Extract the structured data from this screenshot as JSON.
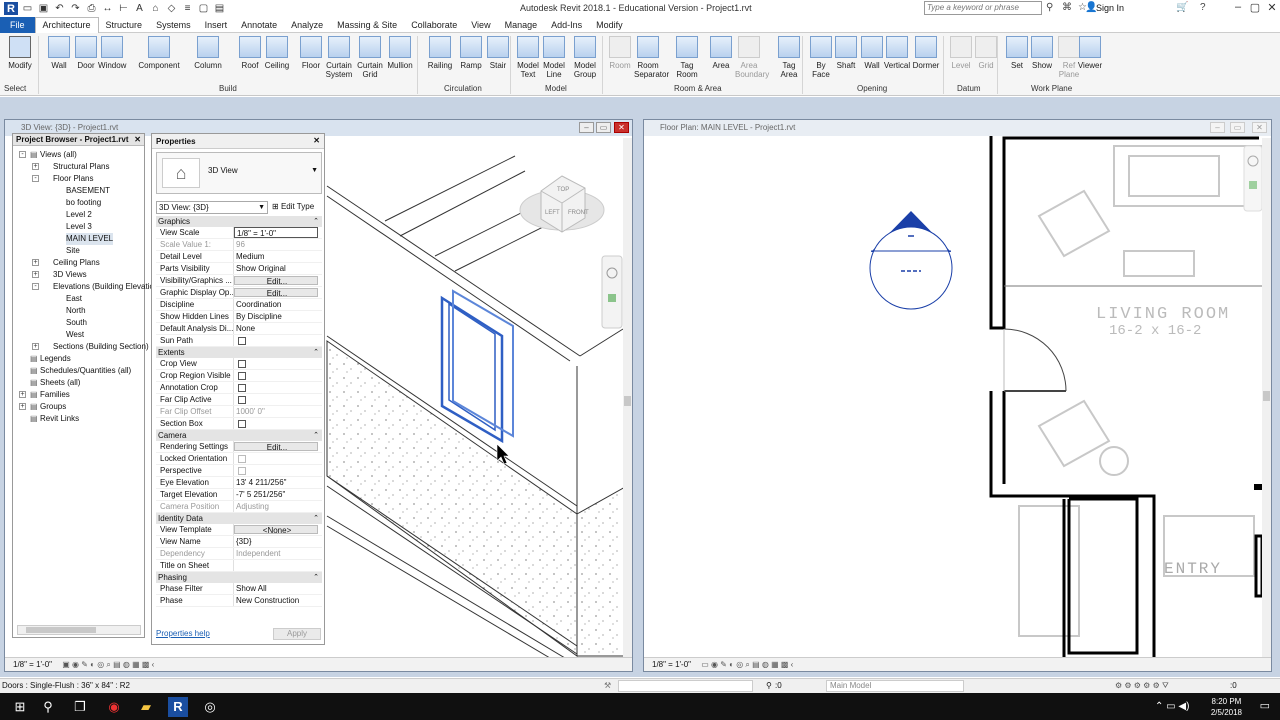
{
  "window": {
    "title": "Autodesk Revit 2018.1 - Educational Version -   Project1.rvt",
    "search_placeholder": "Type a keyword or phrase",
    "sign_in": "Sign In"
  },
  "ribbon": {
    "tabs": [
      "File",
      "Architecture",
      "Structure",
      "Systems",
      "Insert",
      "Annotate",
      "Analyze",
      "Massing & Site",
      "Collaborate",
      "View",
      "Manage",
      "Add-Ins",
      "Modify"
    ],
    "active_tab": "Architecture",
    "tools": [
      {
        "label": "Modify",
        "sub": ""
      },
      {
        "label": "Wall",
        "sub": ""
      },
      {
        "label": "Door",
        "sub": ""
      },
      {
        "label": "Window",
        "sub": ""
      },
      {
        "label": "Component",
        "sub": ""
      },
      {
        "label": "Column",
        "sub": ""
      },
      {
        "label": "Roof",
        "sub": ""
      },
      {
        "label": "Ceiling",
        "sub": ""
      },
      {
        "label": "Floor",
        "sub": ""
      },
      {
        "label": "Curtain",
        "sub": "System"
      },
      {
        "label": "Curtain",
        "sub": "Grid"
      },
      {
        "label": "Mullion",
        "sub": ""
      },
      {
        "label": "Railing",
        "sub": ""
      },
      {
        "label": "Ramp",
        "sub": ""
      },
      {
        "label": "Stair",
        "sub": ""
      },
      {
        "label": "Model",
        "sub": "Text"
      },
      {
        "label": "Model",
        "sub": "Line"
      },
      {
        "label": "Model",
        "sub": "Group"
      },
      {
        "label": "Room",
        "sub": ""
      },
      {
        "label": "Room",
        "sub": "Separator"
      },
      {
        "label": "Tag",
        "sub": "Room"
      },
      {
        "label": "Area",
        "sub": ""
      },
      {
        "label": "Area",
        "sub": "Boundary"
      },
      {
        "label": "Tag",
        "sub": "Area"
      },
      {
        "label": "By",
        "sub": "Face"
      },
      {
        "label": "Shaft",
        "sub": ""
      },
      {
        "label": "Wall",
        "sub": ""
      },
      {
        "label": "Vertical",
        "sub": ""
      },
      {
        "label": "Dormer",
        "sub": ""
      },
      {
        "label": "Level",
        "sub": ""
      },
      {
        "label": "Grid",
        "sub": ""
      },
      {
        "label": "Set",
        "sub": ""
      },
      {
        "label": "Show",
        "sub": ""
      },
      {
        "label": "Ref",
        "sub": "Plane"
      },
      {
        "label": "Viewer",
        "sub": ""
      }
    ],
    "panels": [
      "Select",
      "Build",
      "Circulation",
      "Model",
      "Room & Area",
      "Opening",
      "Datum",
      "Work Plane"
    ]
  },
  "browser": {
    "title": "Project Browser - Project1.rvt",
    "items": [
      {
        "label": "Views (all)",
        "level": 0,
        "exp": "-"
      },
      {
        "label": "Structural Plans",
        "level": 1,
        "exp": "+"
      },
      {
        "label": "Floor Plans",
        "level": 1,
        "exp": "-"
      },
      {
        "label": "BASEMENT",
        "level": 2,
        "exp": ""
      },
      {
        "label": "bo footing",
        "level": 2,
        "exp": ""
      },
      {
        "label": "Level 2",
        "level": 2,
        "exp": ""
      },
      {
        "label": "Level 3",
        "level": 2,
        "exp": ""
      },
      {
        "label": "MAIN LEVEL",
        "level": 2,
        "exp": "",
        "selected": true
      },
      {
        "label": "Site",
        "level": 2,
        "exp": ""
      },
      {
        "label": "Ceiling Plans",
        "level": 1,
        "exp": "+"
      },
      {
        "label": "3D Views",
        "level": 1,
        "exp": "+"
      },
      {
        "label": "Elevations (Building Elevation)",
        "level": 1,
        "exp": "-"
      },
      {
        "label": "East",
        "level": 2,
        "exp": ""
      },
      {
        "label": "North",
        "level": 2,
        "exp": ""
      },
      {
        "label": "South",
        "level": 2,
        "exp": ""
      },
      {
        "label": "West",
        "level": 2,
        "exp": ""
      },
      {
        "label": "Sections (Building Section)",
        "level": 1,
        "exp": "+"
      },
      {
        "label": "Legends",
        "level": 0,
        "exp": ""
      },
      {
        "label": "Schedules/Quantities (all)",
        "level": 0,
        "exp": ""
      },
      {
        "label": "Sheets (all)",
        "level": 0,
        "exp": ""
      },
      {
        "label": "Families",
        "level": 0,
        "exp": "+"
      },
      {
        "label": "Groups",
        "level": 0,
        "exp": "+"
      },
      {
        "label": "Revit Links",
        "level": 0,
        "exp": ""
      }
    ]
  },
  "properties": {
    "title": "Properties",
    "type_name": "3D View",
    "view_selector": "3D View: {3D}",
    "edit_type": "Edit Type",
    "groups": [
      {
        "name": "Graphics",
        "rows": [
          {
            "k": "View Scale",
            "v": "1/8\" = 1'-0\"",
            "kind": "input"
          },
          {
            "k": "Scale Value    1:",
            "v": "96",
            "kind": "dis"
          },
          {
            "k": "Detail Level",
            "v": "Medium"
          },
          {
            "k": "Parts Visibility",
            "v": "Show Original"
          },
          {
            "k": "Visibility/Graphics ...",
            "v": "Edit...",
            "kind": "btn"
          },
          {
            "k": "Graphic Display Op...",
            "v": "Edit...",
            "kind": "btn"
          },
          {
            "k": "Discipline",
            "v": "Coordination"
          },
          {
            "k": "Show Hidden Lines",
            "v": "By Discipline"
          },
          {
            "k": "Default Analysis Di...",
            "v": "None"
          },
          {
            "k": "Sun Path",
            "v": "",
            "kind": "chk"
          }
        ]
      },
      {
        "name": "Extents",
        "rows": [
          {
            "k": "Crop View",
            "v": "",
            "kind": "chk"
          },
          {
            "k": "Crop Region Visible",
            "v": "",
            "kind": "chk"
          },
          {
            "k": "Annotation Crop",
            "v": "",
            "kind": "chk"
          },
          {
            "k": "Far Clip Active",
            "v": "",
            "kind": "chk"
          },
          {
            "k": "Far Clip Offset",
            "v": "1000'  0\"",
            "kind": "dis"
          },
          {
            "k": "Section Box",
            "v": "",
            "kind": "chk"
          }
        ]
      },
      {
        "name": "Camera",
        "rows": [
          {
            "k": "Rendering Settings",
            "v": "Edit...",
            "kind": "btn"
          },
          {
            "k": "Locked Orientation",
            "v": "",
            "kind": "chkdis"
          },
          {
            "k": "Perspective",
            "v": "",
            "kind": "chkdis"
          },
          {
            "k": "Eye Elevation",
            "v": "13'  4 211/256\""
          },
          {
            "k": "Target Elevation",
            "v": "-7'  5 251/256\""
          },
          {
            "k": "Camera Position",
            "v": "Adjusting",
            "kind": "dis"
          }
        ]
      },
      {
        "name": "Identity Data",
        "rows": [
          {
            "k": "View Template",
            "v": "<None>",
            "kind": "btn"
          },
          {
            "k": "View Name",
            "v": "{3D}"
          },
          {
            "k": "Dependency",
            "v": "Independent",
            "kind": "dis"
          },
          {
            "k": "Title on Sheet",
            "v": ""
          }
        ]
      },
      {
        "name": "Phasing",
        "rows": [
          {
            "k": "Phase Filter",
            "v": "Show All"
          },
          {
            "k": "Phase",
            "v": "New Construction"
          }
        ]
      }
    ],
    "help": "Properties help",
    "apply": "Apply"
  },
  "view3d": {
    "title": "3D View: {3D} - Project1.rvt",
    "scale": "1/8\" = 1'-0\""
  },
  "plan": {
    "title": "Floor Plan: MAIN LEVEL - Project1.rvt",
    "scale": "1/8\" = 1'-0\"",
    "room1": "LIVING ROOM",
    "room1_dim": "16-2 x 16-2",
    "room2": "ENTRY"
  },
  "status": {
    "text": "Doors : Single-Flush : 36\" x 84\" : R2",
    "zero": ":0",
    "model": "Main Model",
    "right_zero": ":0"
  },
  "taskbar": {
    "time": "8:20 PM",
    "date": "2/5/2018"
  }
}
